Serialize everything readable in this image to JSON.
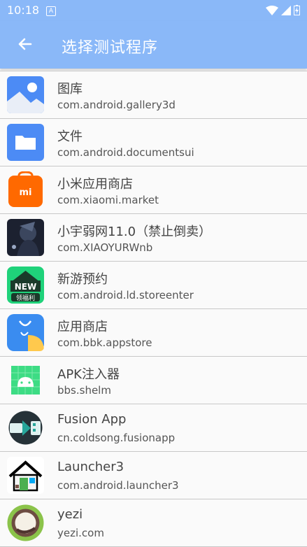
{
  "status_bar": {
    "time": "10:18",
    "notif_glyph": "A"
  },
  "app_bar": {
    "title": "选择测试程序"
  },
  "apps": [
    {
      "name": "图库",
      "package": "com.android.gallery3d",
      "icon": "gallery-icon"
    },
    {
      "name": "文件",
      "package": "com.android.documentsui",
      "icon": "folder-icon"
    },
    {
      "name": "小米应用商店",
      "package": "com.xiaomi.market",
      "icon": "mi-store-icon",
      "badge": "mi"
    },
    {
      "name": "小宇弱网11.0（禁止倒卖）",
      "package": "com.XIAOYURWnb",
      "icon": "anime-avatar-icon"
    },
    {
      "name": "新游预约",
      "package": "com.android.ld.storeenter",
      "icon": "new-games-icon",
      "badge_top": "NEW",
      "badge_bottom": "领福利"
    },
    {
      "name": "应用商店",
      "package": "com.bbk.appstore",
      "icon": "app-store-bag-icon"
    },
    {
      "name": "APK注入器",
      "package": "bbs.shelm",
      "icon": "android-robot-icon"
    },
    {
      "name": "Fusion App",
      "package": "cn.coldsong.fusionapp",
      "icon": "fusion-app-icon"
    },
    {
      "name": "Launcher3",
      "package": "com.android.launcher3",
      "icon": "house-icon"
    },
    {
      "name": "yezi",
      "package": "yezi.com",
      "icon": "coconut-icon"
    }
  ]
}
